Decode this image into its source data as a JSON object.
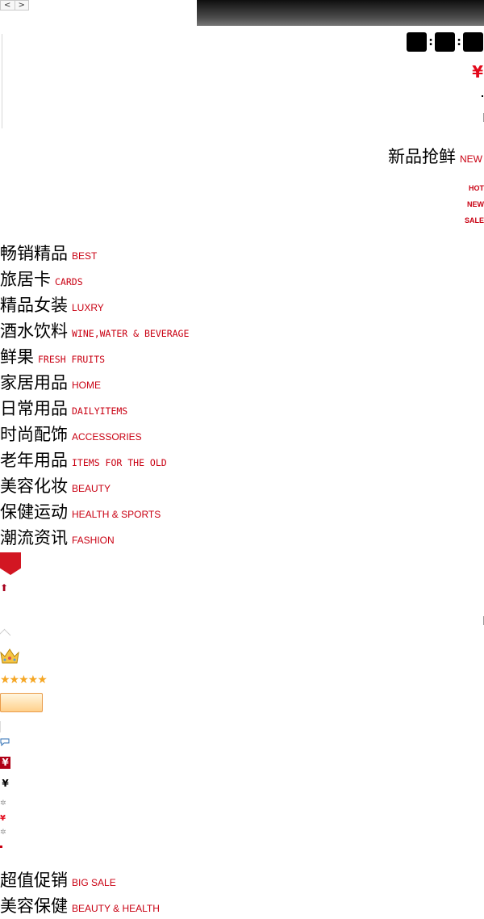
{
  "pager": {
    "prev": "<",
    "next": ">"
  },
  "countdown": {
    "sep1": ":",
    "sep2": ":"
  },
  "price_symbol": "¥",
  "new_section": {
    "title": "新品抢鲜",
    "subtitle": "NEW"
  },
  "tags": [
    "HOT",
    "NEW",
    "SALE"
  ],
  "categories": [
    {
      "cn": "畅销精品",
      "en": "BEST",
      "mono": false
    },
    {
      "cn": "旅居卡",
      "en": "CARDS",
      "mono": true
    },
    {
      "cn": "精品女装",
      "en": "LUXRY",
      "mono": false
    },
    {
      "cn": "酒水饮料",
      "en": "WINE,WATER & BEVERAGE",
      "mono": true
    },
    {
      "cn": "鲜果",
      "en": "FRESH FRUITS",
      "mono": true
    },
    {
      "cn": "家居用品",
      "en": "HOME",
      "mono": false
    },
    {
      "cn": "日常用品",
      "en": "DAILYITEMS",
      "mono": true
    },
    {
      "cn": "时尚配饰",
      "en": "ACCESSORIES",
      "mono": false
    },
    {
      "cn": "老年用品",
      "en": "ITEMS FOR THE OLD",
      "mono": true
    },
    {
      "cn": "美容化妆",
      "en": "BEAUTY",
      "mono": false
    },
    {
      "cn": "保健运动",
      "en": "HEALTH & SPORTS",
      "mono": false
    },
    {
      "cn": "潮流资讯",
      "en": "FASHION",
      "mono": false
    }
  ],
  "icons": {
    "up_arrow": "⬆",
    "stars": "★★★★★",
    "yen_badge_red": "¥",
    "yen_badge_dark": "¥",
    "sparkle": "✲",
    "small_yen": "¥"
  },
  "bottom_sections": [
    {
      "cn": "超值促销",
      "en": "BIG SALE"
    },
    {
      "cn": "美容保健",
      "en": "BEAUTY & HEALTH"
    }
  ]
}
